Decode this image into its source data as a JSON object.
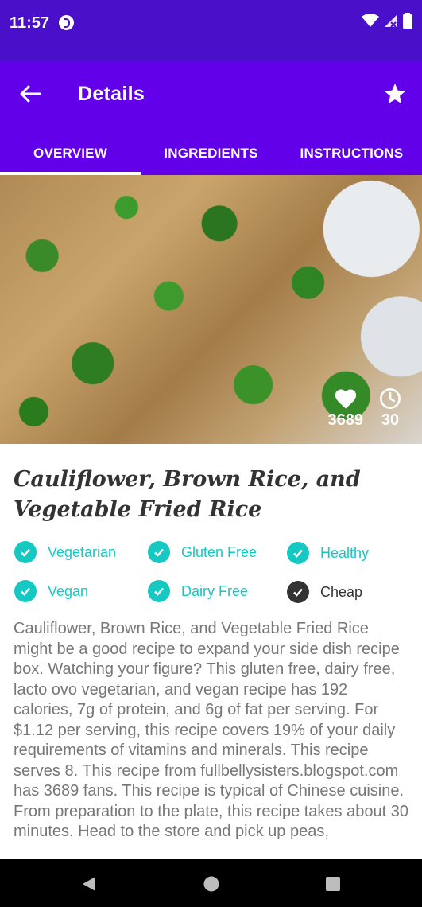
{
  "status": {
    "time": "11:57"
  },
  "header": {
    "title": "Details"
  },
  "tabs": [
    "OVERVIEW",
    "INGREDIENTS",
    "INSTRUCTIONS"
  ],
  "recipe": {
    "likes": "3689",
    "minutes": "30",
    "title": "Cauliflower, Brown Rice, and Vegetable Fried Rice",
    "tags": [
      {
        "label": "Vegetarian",
        "active": true
      },
      {
        "label": "Gluten Free",
        "active": true
      },
      {
        "label": "Healthy",
        "active": true
      },
      {
        "label": "Vegan",
        "active": true
      },
      {
        "label": "Dairy Free",
        "active": true
      },
      {
        "label": "Cheap",
        "active": false
      }
    ],
    "summary": "Cauliflower, Brown Rice, and Vegetable Fried Rice might be a good recipe to expand your side dish recipe box. Watching your figure? This gluten free, dairy free, lacto ovo vegetarian, and vegan recipe has 192 calories, 7g of protein, and 6g of fat per serving. For $1.12 per serving, this recipe covers 19% of your daily requirements of vitamins and minerals. This recipe serves 8. This recipe from fullbellysisters.blogspot.com has 3689 fans. This recipe is typical of Chinese cuisine. From preparation to the plate, this recipe takes about 30 minutes. Head to the store and pick up peas,"
  },
  "colors": {
    "status_bar": "#4a0fc8",
    "app_bar": "#6200ea",
    "accent_teal": "#16c8c2",
    "inactive": "#333333"
  }
}
